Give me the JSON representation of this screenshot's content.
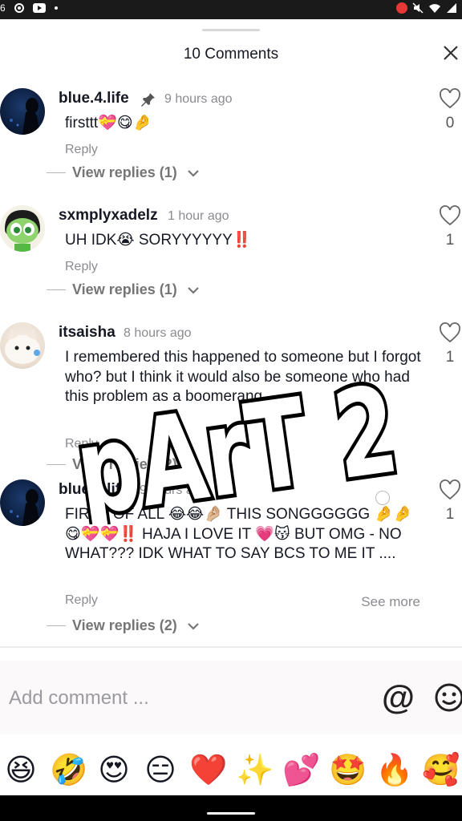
{
  "status_bar": {
    "left_icons": [
      "6",
      "settings-icon",
      "youtube-icon",
      "dot"
    ],
    "right_icons": [
      "record-icon",
      "mute-icon",
      "wifi-icon",
      "signal-icon"
    ]
  },
  "header": {
    "title": "10 Comments",
    "close_icon": "close-icon"
  },
  "comments": [
    {
      "username": "blue.4.life",
      "pinned": true,
      "time": "9 hours ago",
      "text": "firsttt💝😋🤌",
      "reply": "Reply",
      "view_replies": "View replies (1)",
      "likes": "0",
      "avatar": "dark-silhouette"
    },
    {
      "username": "sxmplyxadelz",
      "pinned": false,
      "time": "1 hour ago",
      "text": "UH IDK😭 SORYYYYYY‼️",
      "reply": "Reply",
      "view_replies": "View replies (1)",
      "likes": "1",
      "avatar": "green-cartoon"
    },
    {
      "username": "itsaisha",
      "pinned": false,
      "time": "8 hours ago",
      "text": "I remembered this happened to someone but I forgot who? but I think it would also be someone who had this problem as a boomerang",
      "reply": "Reply",
      "view_replies": "View replies (2)",
      "likes": "1",
      "avatar": "white-cat"
    },
    {
      "username": "blue.4.life",
      "pinned": false,
      "time": "9 hours ago",
      "text": "FIRST OF ALL 😂😂🤌🏼 THIS SONGGGGGG 🤌🤌😋💝💝‼️ HAJA I LOVE IT 💗😽 BUT OMG - NO WHAT??? IDK WHAT TO SAY BCS TO ME IT ....",
      "reply": "Reply",
      "view_replies": "View replies (2)",
      "likes": "1",
      "see_more": "See more",
      "avatar": "dark-silhouette"
    }
  ],
  "overlay_text": "pArT 2",
  "compose": {
    "placeholder": "Add comment ...",
    "at_label": "@"
  },
  "emoji_bar": [
    "😆",
    "🤣",
    "😍",
    "😑",
    "❤️",
    "✨",
    "💕",
    "🤩",
    "🔥",
    "🥰"
  ],
  "colors": {
    "text": "#161823",
    "muted": "#8a8b91",
    "like": "#555555"
  }
}
